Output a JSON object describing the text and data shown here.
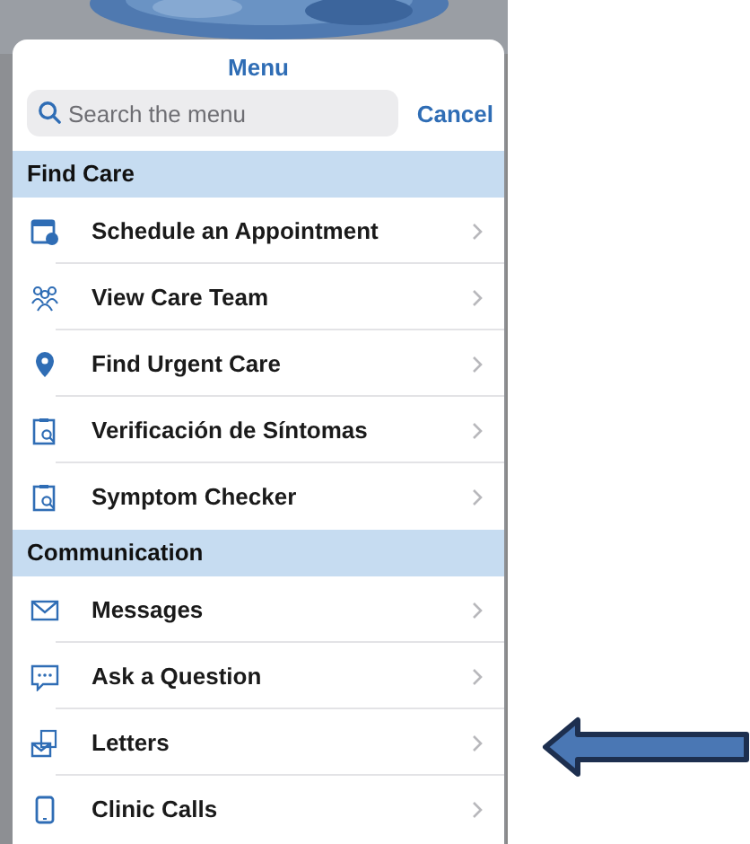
{
  "menu": {
    "title": "Menu",
    "search": {
      "placeholder": "Search the menu"
    },
    "cancel": "Cancel",
    "sections": [
      {
        "header": "Find Care",
        "items": [
          {
            "label": "Schedule an Appointment",
            "kind": "calendar"
          },
          {
            "label": "View Care Team",
            "kind": "team"
          },
          {
            "label": "Find Urgent Care",
            "kind": "pin"
          },
          {
            "label": "Verificación de Síntomas",
            "kind": "checker"
          },
          {
            "label": "Symptom Checker",
            "kind": "checker"
          }
        ]
      },
      {
        "header": "Communication",
        "items": [
          {
            "label": "Messages",
            "kind": "mail"
          },
          {
            "label": "Ask a Question",
            "kind": "chat"
          },
          {
            "label": "Letters",
            "kind": "letter"
          },
          {
            "label": "Clinic Calls",
            "kind": "phone"
          }
        ]
      }
    ]
  }
}
